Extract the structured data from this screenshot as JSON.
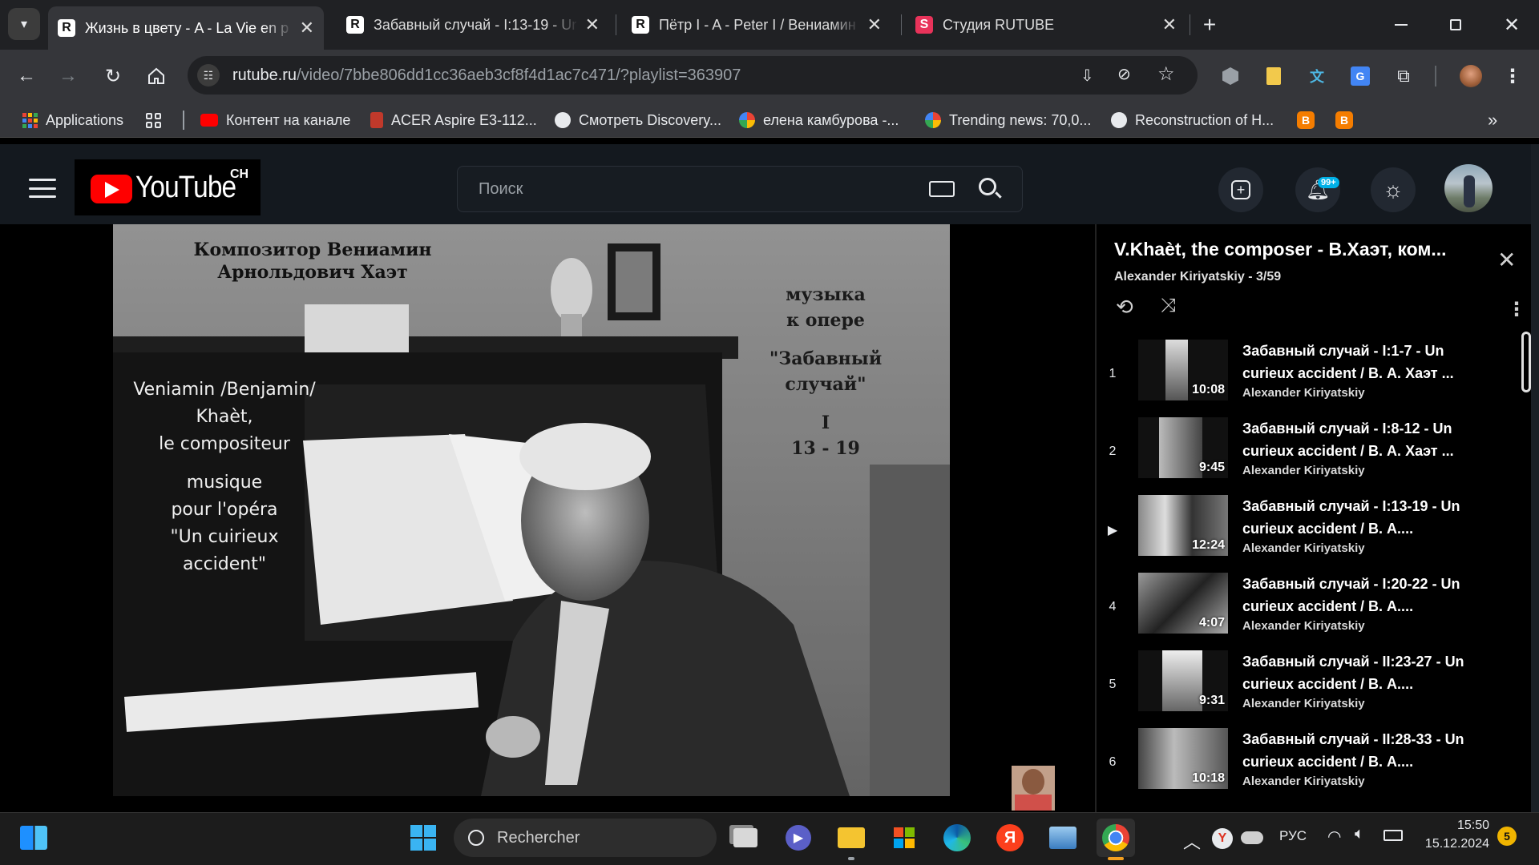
{
  "tabs": [
    {
      "title": "Жизнь в цвету - A - La Vie en p",
      "active": true
    },
    {
      "title": "Забавный случай - I:13-19 - Ur",
      "active": false
    },
    {
      "title": "Пётр I - A - Peter I / Вениамин",
      "active": false
    },
    {
      "title": "Студия RUTUBE",
      "active": false
    }
  ],
  "address": {
    "domain": "rutube.ru",
    "path": "/video/7bbe806dd1cc36aeb3cf8f4d1ac7c471/?playlist=363907"
  },
  "bookmarks": [
    {
      "label": "Applications"
    },
    {
      "label": "Контент на канале"
    },
    {
      "label": "ACER Aspire E3-112..."
    },
    {
      "label": "Смотреть Discovery..."
    },
    {
      "label": "елена камбурова -..."
    },
    {
      "label": "Trending news: 70,0..."
    },
    {
      "label": "Reconstruction of H..."
    }
  ],
  "header": {
    "logo_text": "YouTube",
    "region": "CH",
    "search_placeholder": "Поиск",
    "notif_badge": "99+"
  },
  "video_overlay": {
    "caption_ru": [
      "Композитор Вениамин",
      "Арнольдович Хаэт"
    ],
    "caption_fr": [
      "Veniamin /Benjamin/",
      "Khaèt,",
      "le compositeur",
      "musique",
      "pour l'opéra",
      "\"Un cuirieux",
      "accident\""
    ],
    "caption_right": [
      "музыка",
      "к опере",
      "\"Забавный",
      "случай\"",
      "I",
      "13 - 19"
    ]
  },
  "playlist": {
    "title": "V.Khaèt, the composer - В.Хаэт, ком...",
    "subtitle": "Alexander Kiriyatskiy - 3/59",
    "items": [
      {
        "num": "1",
        "title": "Забавный случай - I:1-7 - Un curieux accident / В. А. Хаэт ...",
        "author": "Alexander Kiriyatskiy",
        "duration": "10:08"
      },
      {
        "num": "2",
        "title": "Забавный случай - I:8-12 - Un curieux accident / В. А. Хаэт ...",
        "author": "Alexander Kiriyatskiy",
        "duration": "9:45"
      },
      {
        "num": "▶",
        "title": "Забавный случай - I:13-19 - Un curieux accident / В. А....",
        "author": "Alexander Kiriyatskiy",
        "duration": "12:24"
      },
      {
        "num": "4",
        "title": "Забавный случай - I:20-22 - Un curieux accident / В. А....",
        "author": "Alexander Kiriyatskiy",
        "duration": "4:07"
      },
      {
        "num": "5",
        "title": "Забавный случай - II:23-27 - Un curieux accident / В. А....",
        "author": "Alexander Kiriyatskiy",
        "duration": "9:31"
      },
      {
        "num": "6",
        "title": "Забавный случай - II:28-33 - Un curieux accident / В. А....",
        "author": "Alexander Kiriyatskiy",
        "duration": "10:18"
      }
    ]
  },
  "taskbar": {
    "search_label": "Rechercher",
    "lang": "РУС",
    "time": "15:50",
    "date": "15.12.2024",
    "notif_count": "5"
  }
}
